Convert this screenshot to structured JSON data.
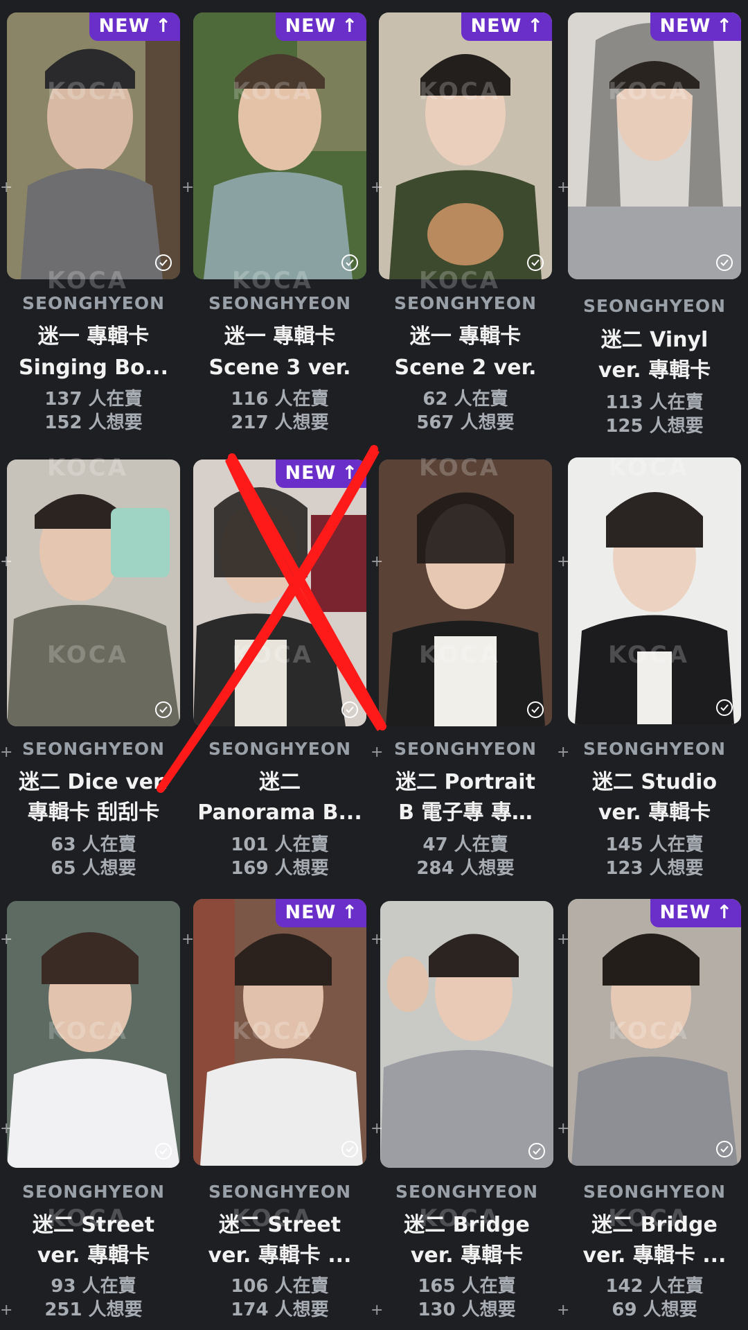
{
  "brand_watermark": "KOCA",
  "badge_new_label": "NEW",
  "colors": {
    "background": "#1e1f23",
    "badge": "#6a2fc9",
    "member_text": "#9aa0a8",
    "title_text": "#f2f2f2",
    "stat_text": "#a8adb4",
    "cross_out": "#ff1a1a"
  },
  "cards": [
    {
      "member": "SEONGHYEON",
      "name_line1": "迷一 專輯卡",
      "name_line2": "Singing Bo...",
      "selling": "137 人在賣",
      "wanting": "152 人想要",
      "new": true,
      "crossed_out": false
    },
    {
      "member": "SEONGHYEON",
      "name_line1": "迷一 專輯卡",
      "name_line2": "Scene 3 ver.",
      "selling": "116 人在賣",
      "wanting": "217 人想要",
      "new": true,
      "crossed_out": false
    },
    {
      "member": "SEONGHYEON",
      "name_line1": "迷一 專輯卡",
      "name_line2": "Scene 2 ver.",
      "selling": "62 人在賣",
      "wanting": "567 人想要",
      "new": true,
      "crossed_out": false
    },
    {
      "member": "SEONGHYEON",
      "name_line1": "迷二 Vinyl",
      "name_line2": "ver. 專輯卡",
      "selling": "113 人在賣",
      "wanting": "125 人想要",
      "new": true,
      "crossed_out": false
    },
    {
      "member": "SEONGHYEON",
      "name_line1": "迷二 Dice ver.",
      "name_line2": "專輯卡 刮刮卡",
      "selling": "63 人在賣",
      "wanting": "65 人想要",
      "new": false,
      "crossed_out": false
    },
    {
      "member": "SEONGHYEON",
      "name_line1": "迷二",
      "name_line2": "Panorama B...",
      "selling": "101 人在賣",
      "wanting": "169 人想要",
      "new": true,
      "crossed_out": true
    },
    {
      "member": "SEONGHYEON",
      "name_line1": "迷二 Portrait",
      "name_line2": "B 電子專 專…",
      "selling": "47 人在賣",
      "wanting": "284 人想要",
      "new": false,
      "crossed_out": false
    },
    {
      "member": "SEONGHYEON",
      "name_line1": "迷二 Studio",
      "name_line2": "ver. 專輯卡",
      "selling": "145 人在賣",
      "wanting": "123 人想要",
      "new": false,
      "crossed_out": false
    },
    {
      "member": "SEONGHYEON",
      "name_line1": "迷二 Street",
      "name_line2": "ver. 專輯卡",
      "selling": "93 人在賣",
      "wanting": "251 人想要",
      "new": false,
      "crossed_out": false
    },
    {
      "member": "SEONGHYEON",
      "name_line1": "迷二 Street",
      "name_line2": "ver. 專輯卡 ...",
      "selling": "106 人在賣",
      "wanting": "174 人想要",
      "new": true,
      "crossed_out": false
    },
    {
      "member": "SEONGHYEON",
      "name_line1": "迷二 Bridge",
      "name_line2": "ver. 專輯卡",
      "selling": "165 人在賣",
      "wanting": "130 人想要",
      "new": false,
      "crossed_out": false
    },
    {
      "member": "SEONGHYEON",
      "name_line1": "迷二 Bridge",
      "name_line2": "ver. 專輯卡 ...",
      "selling": "142 人在賣",
      "wanting": "69 人想要",
      "new": true,
      "crossed_out": false
    }
  ]
}
